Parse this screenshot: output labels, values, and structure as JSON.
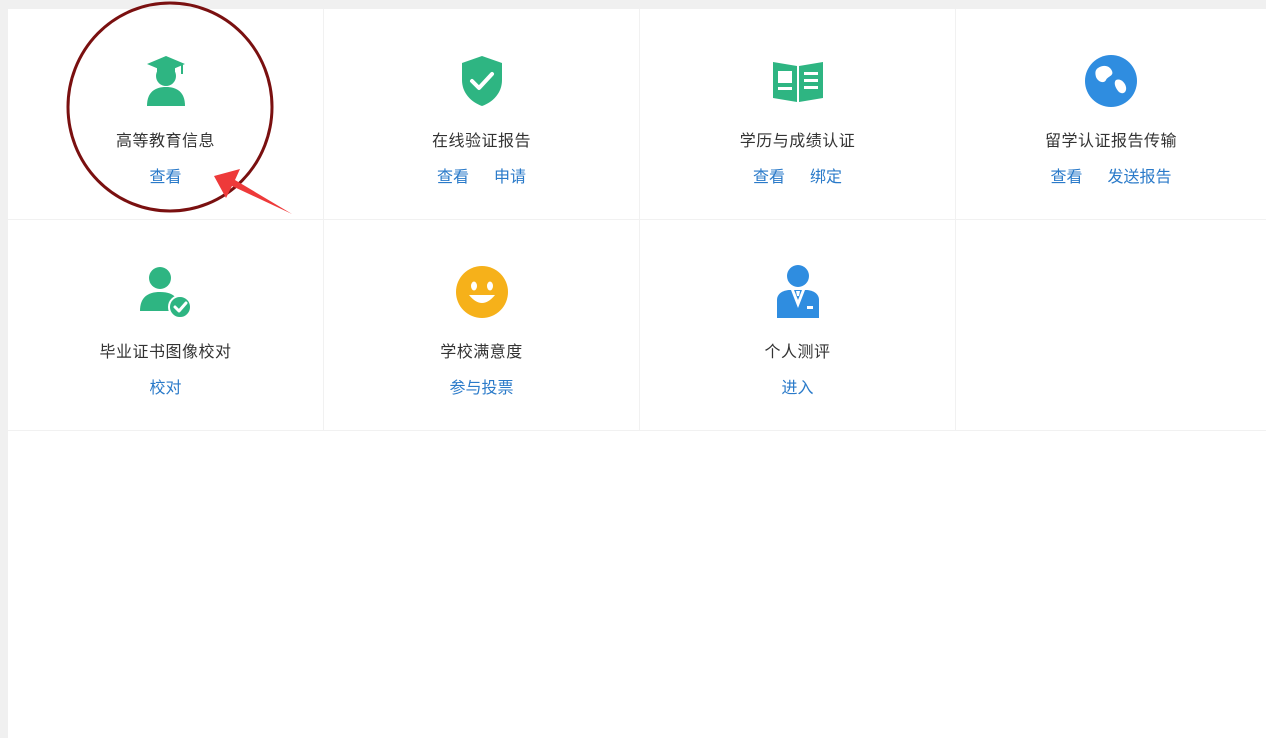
{
  "cards": [
    {
      "icon": "graduate-icon",
      "title": "高等教育信息",
      "links": [
        "查看"
      ]
    },
    {
      "icon": "shield-check-icon",
      "title": "在线验证报告",
      "links": [
        "查看",
        "申请"
      ]
    },
    {
      "icon": "document-icon",
      "title": "学历与成绩认证",
      "links": [
        "查看",
        "绑定"
      ]
    },
    {
      "icon": "globe-icon",
      "title": "留学认证报告传输",
      "links": [
        "查看",
        "发送报告"
      ]
    },
    {
      "icon": "user-check-icon",
      "title": "毕业证书图像校对",
      "links": [
        "校对"
      ]
    },
    {
      "icon": "smiley-icon",
      "title": "学校满意度",
      "links": [
        "参与投票"
      ]
    },
    {
      "icon": "person-tie-icon",
      "title": "个人测评",
      "links": [
        "进入"
      ]
    }
  ],
  "colors": {
    "green": "#2eb582",
    "blue": "#2f8de0",
    "yellow": "#f6b11a",
    "link": "#2a7ac9",
    "annotation_circle": "#7a1010",
    "annotation_arrow": "#ee3a3a"
  }
}
